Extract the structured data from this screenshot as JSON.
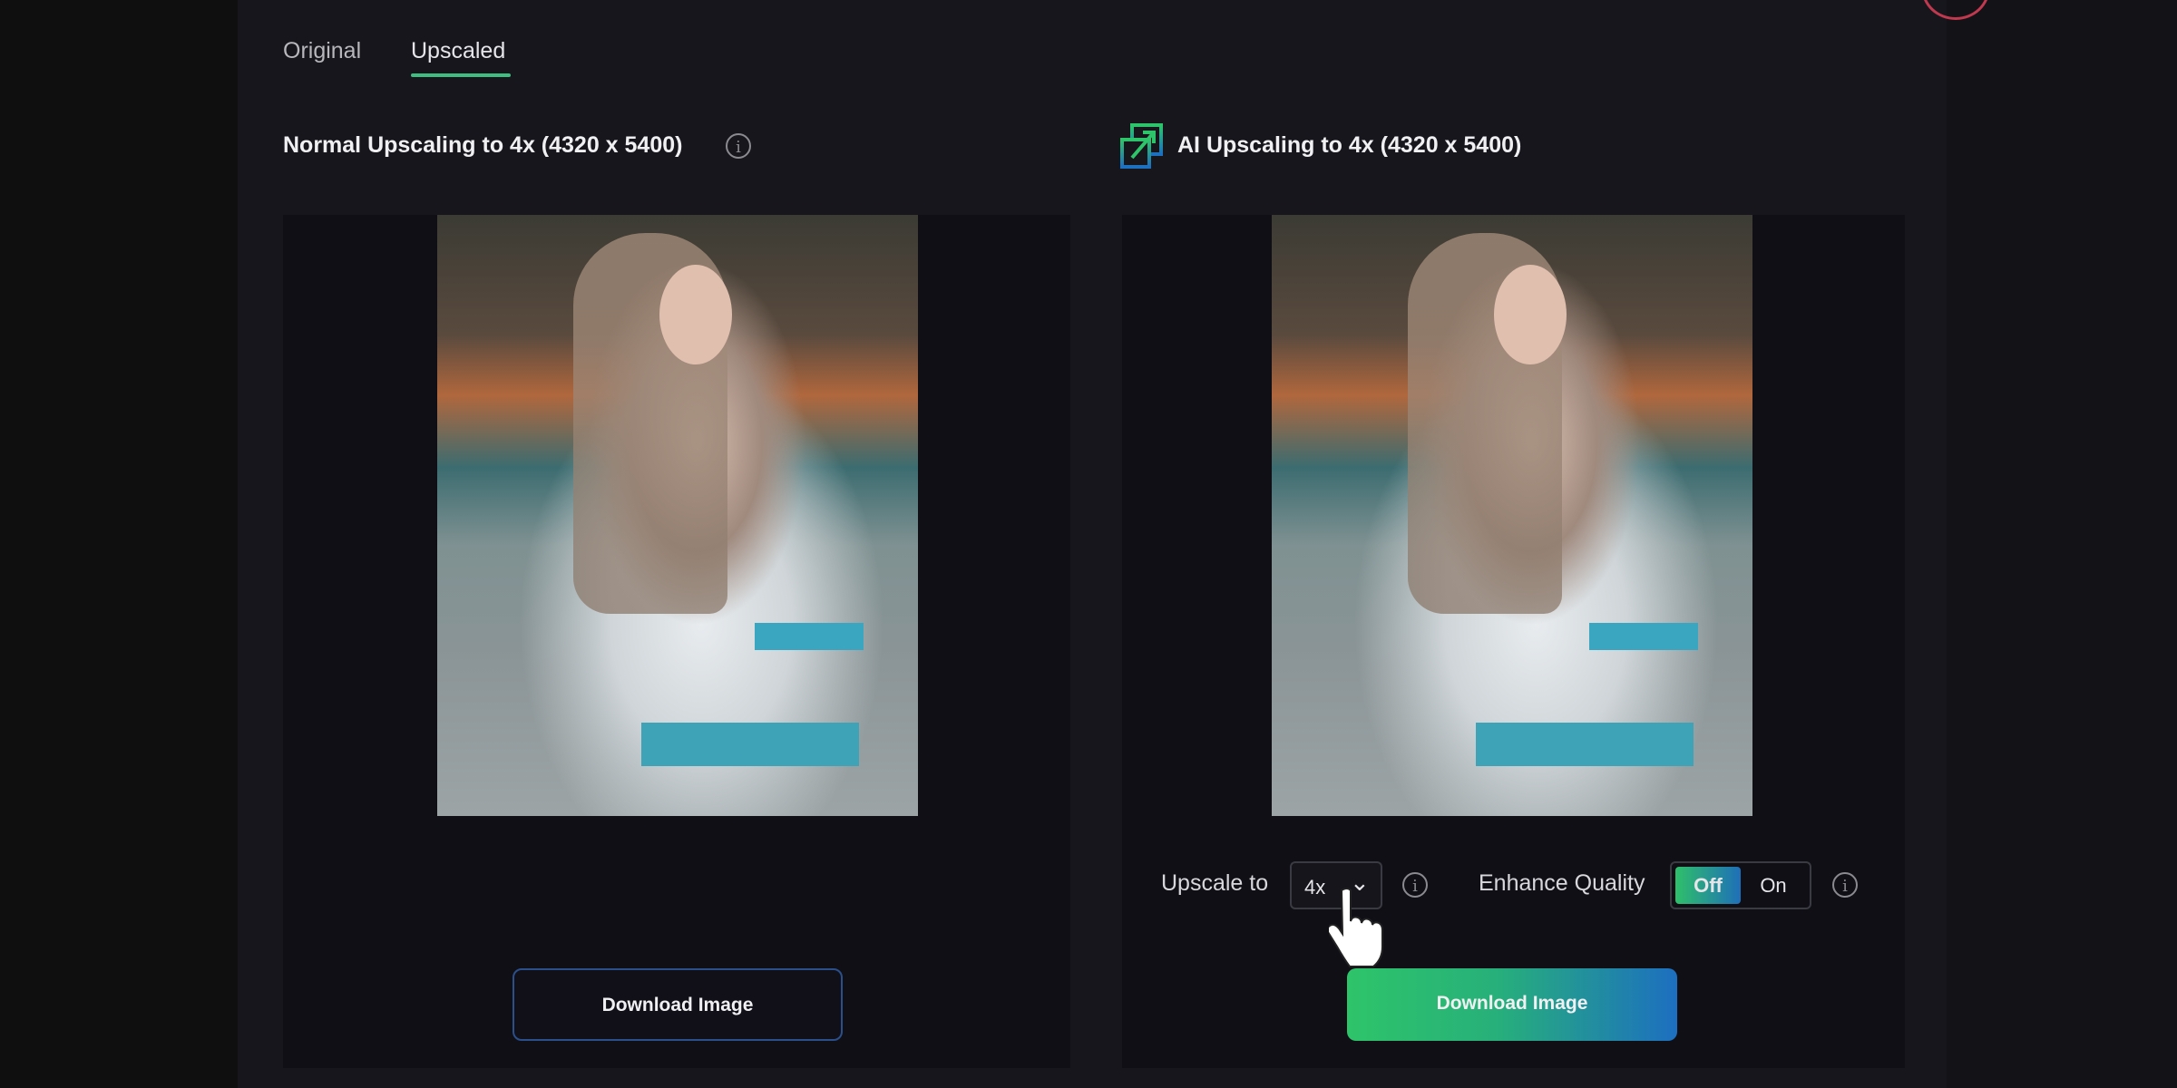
{
  "tabs": [
    {
      "label": "Original",
      "active": false
    },
    {
      "label": "Upscaled",
      "active": true
    }
  ],
  "left": {
    "heading": "Normal Upscaling to 4x (4320 x 5400)",
    "download_label": "Download Image"
  },
  "right": {
    "heading": "AI Upscaling to 4x (4320 x 5400)",
    "download_label": "Download Image"
  },
  "controls": {
    "upscale_label": "Upscale to",
    "upscale_value": "4x",
    "enhance_label": "Enhance Quality",
    "toggle_off": "Off",
    "toggle_on": "On",
    "toggle_selected": "Off"
  },
  "colors": {
    "accent_green": "#3dbf7f",
    "accent_blue": "#1d6fc0",
    "panel": "#18161d"
  },
  "icons": {
    "info": "info-circle-icon",
    "ai": "upscale-arrow-icon",
    "cursor": "hand-pointer-icon"
  }
}
